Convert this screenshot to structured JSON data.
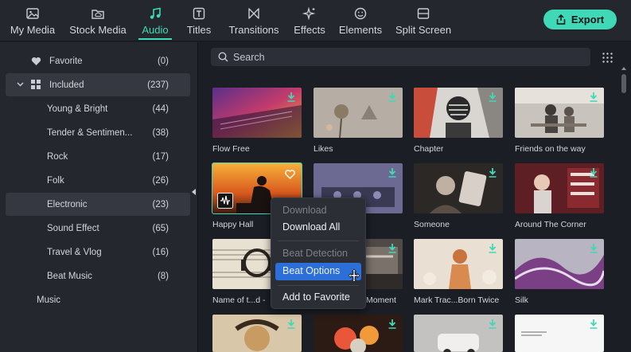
{
  "tabs": [
    {
      "label": "My Media",
      "icon": "image-icon"
    },
    {
      "label": "Stock Media",
      "icon": "folder-cloud-icon"
    },
    {
      "label": "Audio",
      "icon": "music-note-icon",
      "active": true
    },
    {
      "label": "Titles",
      "icon": "text-t-icon"
    },
    {
      "label": "Transitions",
      "icon": "transition-icon"
    },
    {
      "label": "Effects",
      "icon": "sparkle-icon"
    },
    {
      "label": "Elements",
      "icon": "smiley-icon"
    },
    {
      "label": "Split Screen",
      "icon": "split-screen-icon"
    }
  ],
  "export_label": "Export",
  "sidebar": {
    "favorite": {
      "label": "Favorite",
      "count": "(0)"
    },
    "included": {
      "label": "Included",
      "count": "(237)"
    },
    "items": [
      {
        "label": "Young & Bright",
        "count": "(44)"
      },
      {
        "label": "Tender & Sentimen...",
        "count": "(38)"
      },
      {
        "label": "Rock",
        "count": "(17)"
      },
      {
        "label": "Folk",
        "count": "(26)"
      },
      {
        "label": "Electronic",
        "count": "(23)",
        "selected": true
      },
      {
        "label": "Sound Effect",
        "count": "(65)"
      },
      {
        "label": "Travel & Vlog",
        "count": "(16)"
      },
      {
        "label": "Beat Music",
        "count": "(8)"
      }
    ],
    "music": {
      "label": "Music"
    }
  },
  "search": {
    "placeholder": "Search"
  },
  "cards": [
    {
      "title": "Flow Free"
    },
    {
      "title": "Likes"
    },
    {
      "title": "Chapter"
    },
    {
      "title": "Friends on the way"
    },
    {
      "title": "Happy Hall"
    },
    {
      "title": ""
    },
    {
      "title": "Someone"
    },
    {
      "title": "Around The Corner"
    },
    {
      "title": "Name of t...d -"
    },
    {
      "title": "Moment"
    },
    {
      "title": "Mark Trac...Born Twice"
    },
    {
      "title": "Silk"
    },
    {
      "title": ""
    },
    {
      "title": ""
    },
    {
      "title": ""
    },
    {
      "title": ""
    }
  ],
  "context_menu": {
    "download": "Download",
    "download_all": "Download All",
    "beat_detection": "Beat Detection",
    "beat_options": "Beat Options",
    "add_to_favorite": "Add to Favorite"
  },
  "colors": {
    "accent": "#3fd9b7",
    "menu_highlight": "#2d6fd8",
    "background": "#1b1e25",
    "panel": "#24272e"
  }
}
